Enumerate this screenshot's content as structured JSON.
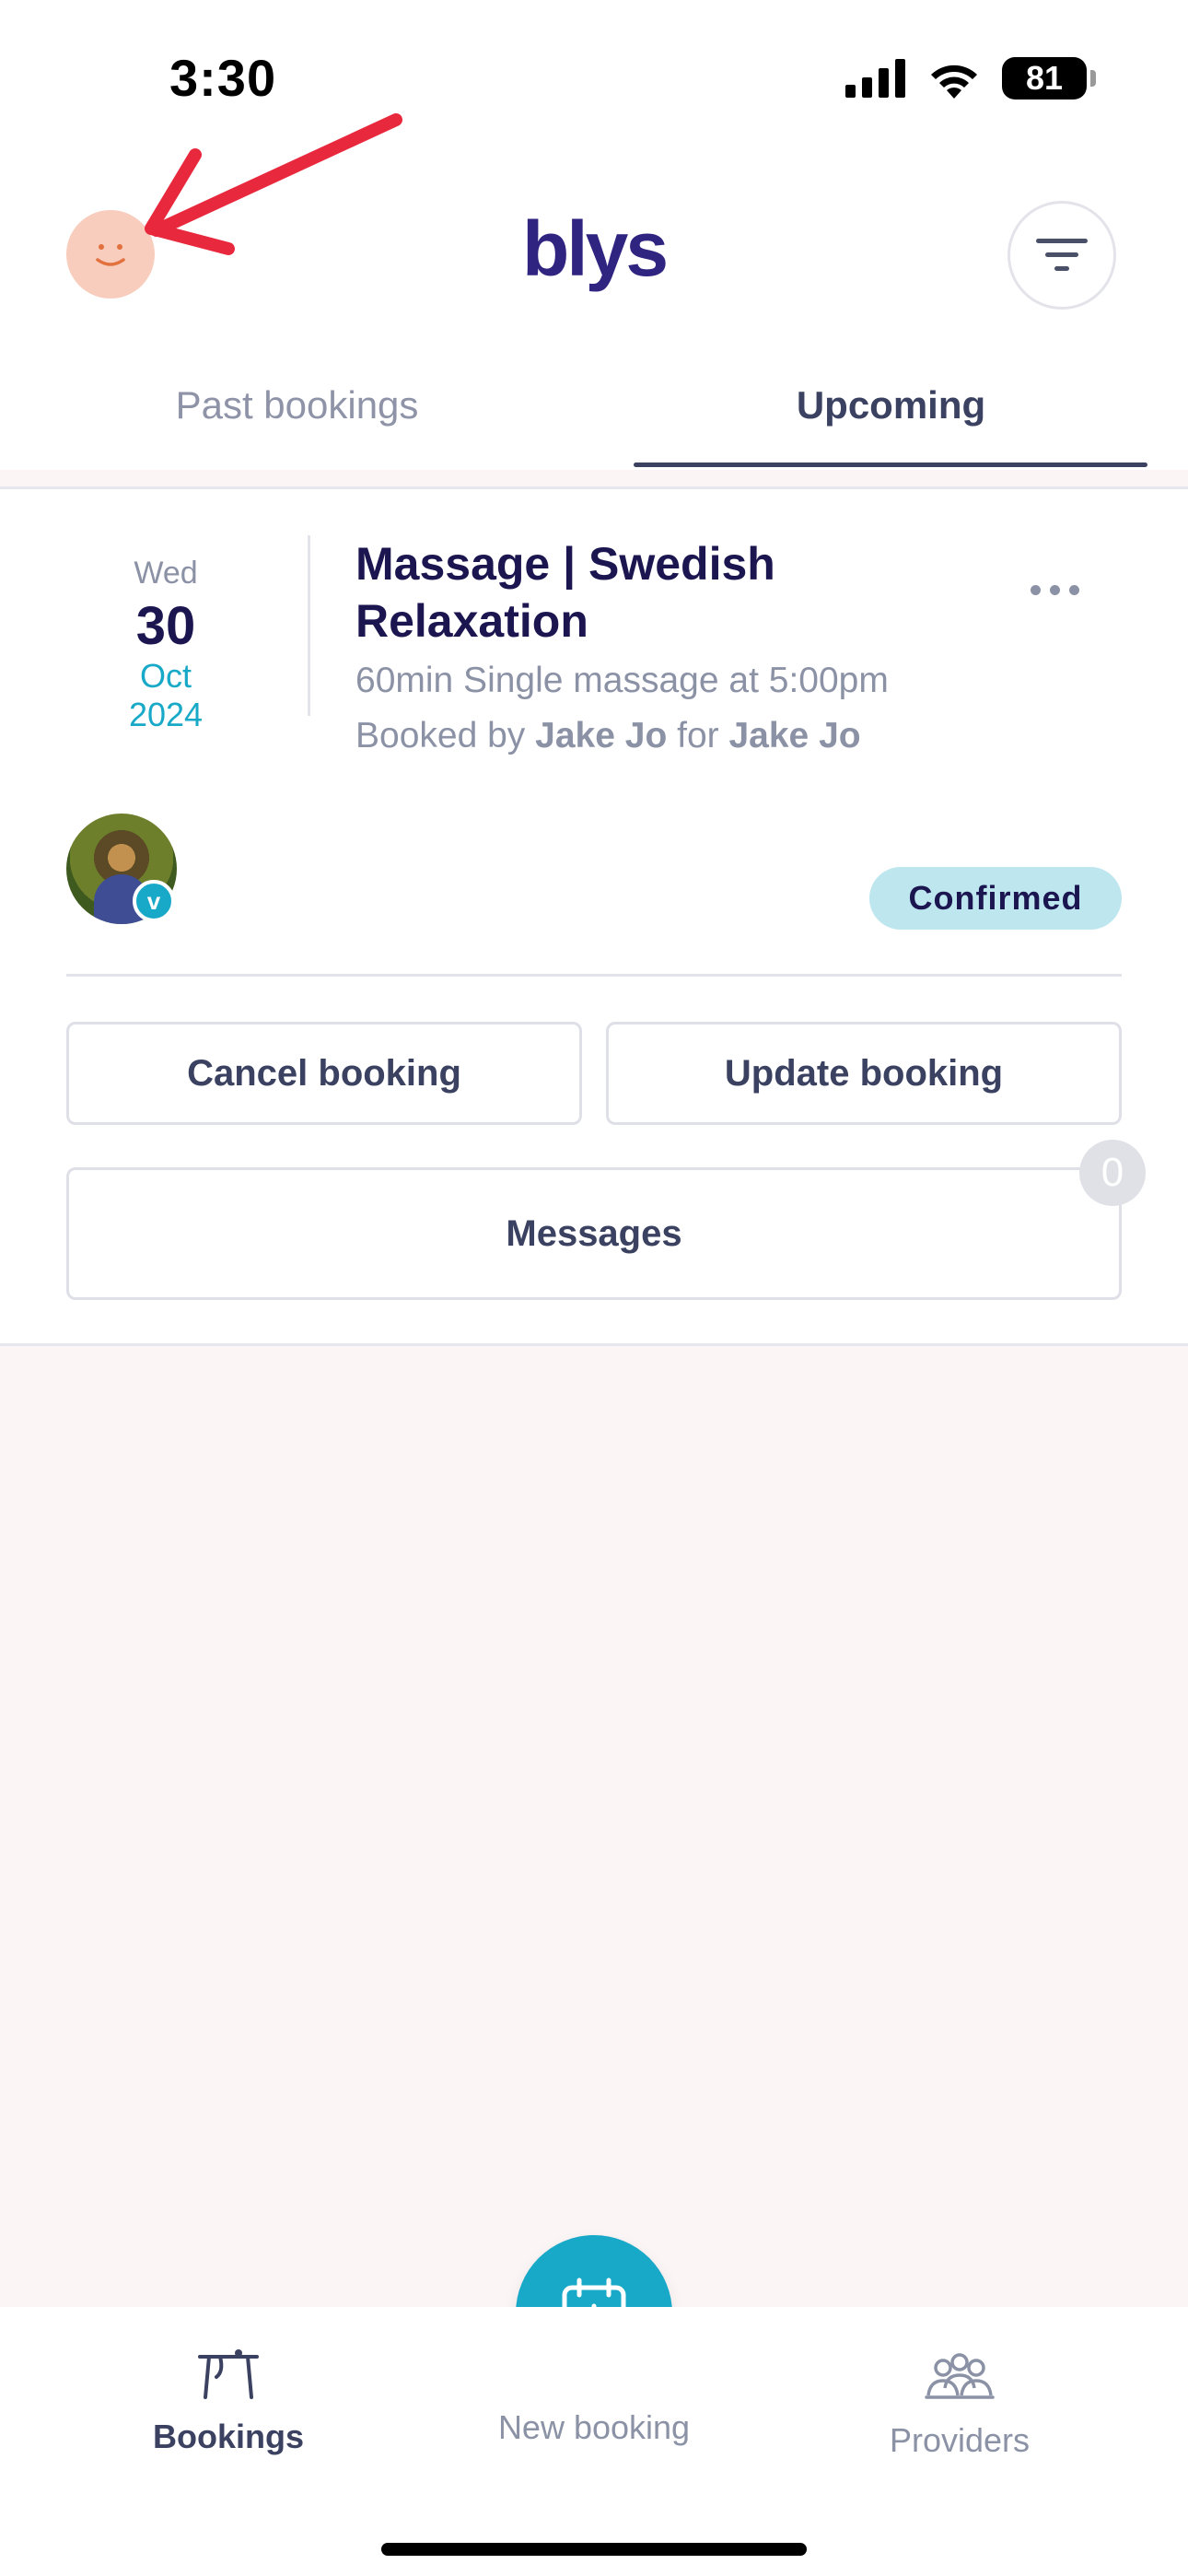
{
  "status_bar": {
    "time": "3:30",
    "battery": "81",
    "icons": [
      "cellular-signal-icon",
      "wifi-icon",
      "battery-icon"
    ]
  },
  "header": {
    "logo": "blys",
    "profile_icon": "smiley-face-icon",
    "filter_icon": "filter-icon"
  },
  "tabs": [
    {
      "label": "Past bookings",
      "active": false
    },
    {
      "label": "Upcoming",
      "active": true
    }
  ],
  "booking": {
    "date": {
      "weekday": "Wed",
      "day": "30",
      "month": "Oct",
      "year": "2024"
    },
    "title": "Massage | Swedish Relaxation",
    "details": "60min Single massage at 5:00pm",
    "booked_by_prefix": "Booked by",
    "booked_by": "Jake Jo",
    "for_prefix": "for",
    "for_name": "Jake Jo",
    "provider_badge": "v",
    "status": "Confirmed",
    "status_color": "#bde6ef",
    "actions": {
      "cancel": "Cancel booking",
      "update": "Update booking",
      "messages": "Messages",
      "message_count": "0"
    }
  },
  "bottom_nav": {
    "items": [
      {
        "label": "Bookings",
        "icon": "bookings-icon",
        "active": true
      },
      {
        "label": "New booking",
        "icon": "calendar-plus-icon",
        "active": false
      },
      {
        "label": "Providers",
        "icon": "providers-icon",
        "active": false
      }
    ]
  },
  "colors": {
    "brand": "#2f2480",
    "accent": "#19a9c8",
    "annotation": "#e8283c"
  }
}
